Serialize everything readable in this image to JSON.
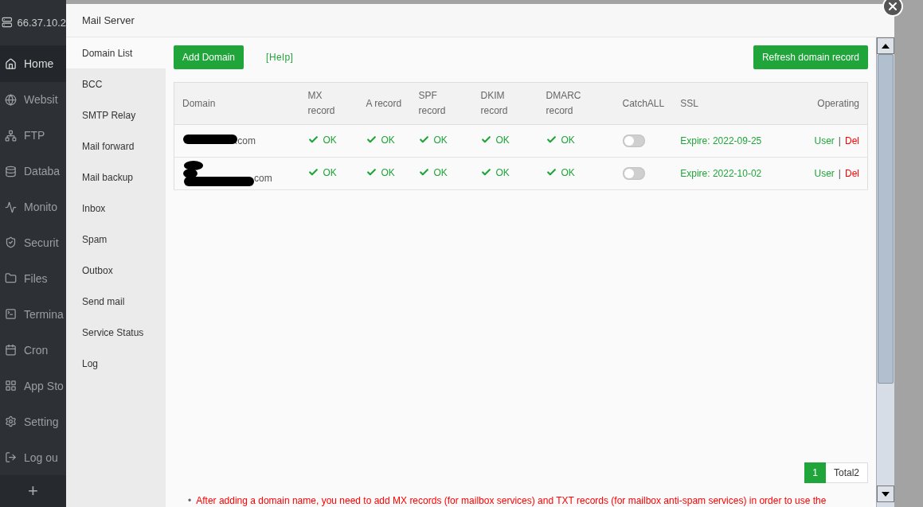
{
  "sidebar": {
    "server": "66.37.10.2",
    "items": [
      {
        "label": "Home",
        "selected": true
      },
      {
        "label": "Websit",
        "selected": false
      },
      {
        "label": "FTP",
        "selected": false
      },
      {
        "label": "Databa",
        "selected": false
      },
      {
        "label": "Monito",
        "selected": false
      },
      {
        "label": "Securit",
        "selected": false
      },
      {
        "label": "Files",
        "selected": false
      },
      {
        "label": "Termina",
        "selected": false
      },
      {
        "label": "Cron",
        "selected": false
      },
      {
        "label": "App Sto",
        "selected": false
      },
      {
        "label": "Setting",
        "selected": false
      },
      {
        "label": "Log ou",
        "selected": false
      }
    ],
    "add": "+"
  },
  "modal": {
    "title": "Mail Server",
    "nav": [
      {
        "label": "Domain List",
        "selected": true
      },
      {
        "label": "BCC",
        "selected": false
      },
      {
        "label": "SMTP Relay",
        "selected": false
      },
      {
        "label": "Mail forward",
        "selected": false
      },
      {
        "label": "Mail backup",
        "selected": false
      },
      {
        "label": "Inbox",
        "selected": false
      },
      {
        "label": "Spam",
        "selected": false
      },
      {
        "label": "Outbox",
        "selected": false
      },
      {
        "label": "Send mail",
        "selected": false
      },
      {
        "label": "Service Status",
        "selected": false
      },
      {
        "label": "Log",
        "selected": false
      }
    ],
    "toolbar": {
      "add": "Add Domain",
      "help": "[Help]",
      "refresh": "Refresh domain record"
    },
    "table": {
      "columns": [
        {
          "label": "Domain",
          "kind": "domain"
        },
        {
          "label": "MX record",
          "kind": "record"
        },
        {
          "label": "A record",
          "kind": "record"
        },
        {
          "label": "SPF record",
          "kind": "record"
        },
        {
          "label": "DKIM record",
          "kind": "record"
        },
        {
          "label": "DMARC record",
          "kind": "record"
        },
        {
          "label": "CatchALL",
          "kind": "toggle"
        },
        {
          "label": "SSL",
          "kind": "ssl"
        },
        {
          "label": "Operating",
          "kind": "ops"
        }
      ],
      "rows": [
        {
          "domain": ".com",
          "redacted": true,
          "records": [
            "OK",
            "OK",
            "OK",
            "OK",
            "OK"
          ],
          "catchall": false,
          "ssl": "Expire: 2022-09-25",
          "actions": [
            {
              "label": "User",
              "kind": "edit"
            },
            {
              "label": "Del",
              "kind": "delete"
            }
          ],
          "separator": "|"
        },
        {
          "domain": "com",
          "redacted": true,
          "records": [
            "OK",
            "OK",
            "OK",
            "OK",
            "OK"
          ],
          "catchall": false,
          "ssl": "Expire: 2022-10-02",
          "actions": [
            {
              "label": "User",
              "kind": "edit"
            },
            {
              "label": "Del",
              "kind": "delete"
            }
          ],
          "separator": "|"
        }
      ]
    },
    "pagination": {
      "pages": [
        {
          "label": "1",
          "selected": true
        }
      ],
      "total": "Total2"
    },
    "notes": [
      {
        "bullet": "•",
        "text": "After adding a domain name, you need to add MX records (for mailbox services) and TXT records (for mailbox anti-spam services) in order to use the"
      }
    ]
  }
}
